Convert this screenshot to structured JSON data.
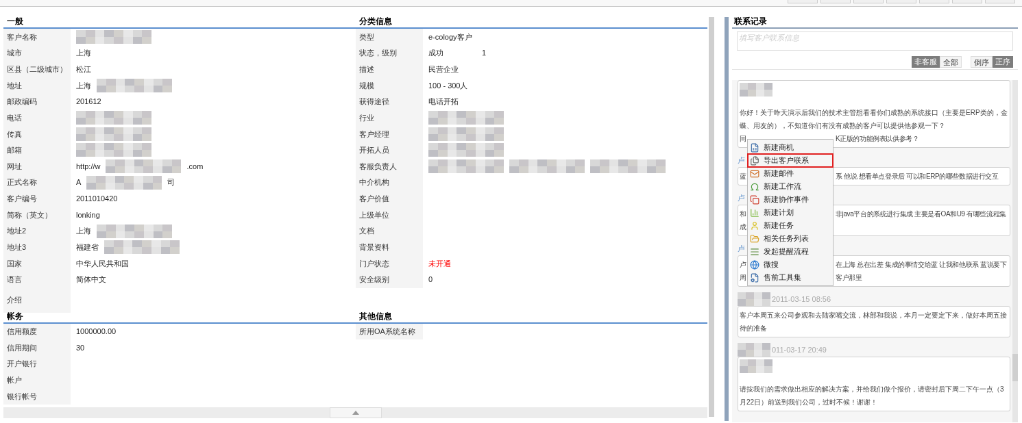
{
  "sections": [
    {
      "left": {
        "title": "一般",
        "fields": [
          {
            "label": "客户名称",
            "segments": [
              {
                "kind": "redacted"
              }
            ]
          },
          {
            "label": "城市",
            "segments": [
              {
                "kind": "text",
                "text": "上海"
              }
            ]
          },
          {
            "label": "区县（二级城市）",
            "segments": [
              {
                "kind": "text",
                "text": "松江"
              }
            ]
          },
          {
            "label": "地址",
            "segments": [
              {
                "kind": "text",
                "text": "上海"
              },
              {
                "kind": "redacted"
              }
            ]
          },
          {
            "label": "邮政编码",
            "segments": [
              {
                "kind": "text",
                "text": "201612"
              }
            ]
          },
          {
            "label": "电话",
            "segments": [
              {
                "kind": "redacted"
              }
            ]
          },
          {
            "label": "传真",
            "segments": [
              {
                "kind": "redacted"
              }
            ]
          },
          {
            "label": "邮箱",
            "segments": [
              {
                "kind": "redacted"
              }
            ]
          },
          {
            "label": "网址",
            "segments": [
              {
                "kind": "text",
                "text": "http://w"
              },
              {
                "kind": "redacted"
              },
              {
                "kind": "text",
                "text": ".com"
              }
            ]
          },
          {
            "label": "正式名称",
            "segments": [
              {
                "kind": "text",
                "text": "A"
              },
              {
                "kind": "redacted"
              },
              {
                "kind": "text",
                "text": "司"
              }
            ]
          },
          {
            "label": "客户编号",
            "segments": [
              {
                "kind": "text",
                "text": "2011010420"
              }
            ]
          },
          {
            "label": "简称（英文）",
            "segments": [
              {
                "kind": "text",
                "text": "lonking"
              }
            ]
          },
          {
            "label": "地址2",
            "segments": [
              {
                "kind": "text",
                "text": "上海"
              },
              {
                "kind": "redacted"
              }
            ]
          },
          {
            "label": "地址3",
            "segments": [
              {
                "kind": "text",
                "text": "福建省"
              },
              {
                "kind": "redacted"
              }
            ]
          },
          {
            "label": "国家",
            "segments": [
              {
                "kind": "text",
                "text": "中华人民共和国"
              }
            ]
          },
          {
            "label": "语言",
            "segments": [
              {
                "kind": "text",
                "text": "简体中文"
              }
            ]
          },
          {
            "label": "介绍",
            "tall": true
          }
        ]
      },
      "right": {
        "title": "分类信息",
        "fields": [
          {
            "label": "类型",
            "segments": [
              {
                "kind": "text",
                "text": "e-cology客户"
              }
            ]
          },
          {
            "label": "状态，级别",
            "segments": [
              {
                "kind": "text",
                "text": "成功"
              },
              {
                "kind": "text",
                "text": "1"
              }
            ]
          },
          {
            "label": "描述",
            "segments": [
              {
                "kind": "text",
                "text": "民营企业"
              }
            ]
          },
          {
            "label": "规模",
            "segments": [
              {
                "kind": "text",
                "text": "100 - 300人"
              }
            ]
          },
          {
            "label": "获得途径",
            "segments": [
              {
                "kind": "text",
                "text": "电话开拓"
              }
            ]
          },
          {
            "label": "行业",
            "segments": [
              {
                "kind": "redacted"
              }
            ]
          },
          {
            "label": "客户经理",
            "segments": [
              {
                "kind": "redacted"
              }
            ]
          },
          {
            "label": "开拓人员",
            "segments": [
              {
                "kind": "redacted"
              }
            ]
          },
          {
            "label": "客服负责人",
            "segments": [
              {
                "kind": "redacted"
              },
              {
                "kind": "redacted"
              },
              {
                "kind": "redacted"
              }
            ]
          },
          {
            "label": "中介机构"
          },
          {
            "label": "客户价值"
          },
          {
            "label": "上级单位"
          },
          {
            "label": "文档"
          },
          {
            "label": "背景资料"
          },
          {
            "label": "门户状态",
            "segments": [
              {
                "kind": "alert",
                "text": "未开通"
              }
            ]
          },
          {
            "label": "安全级别",
            "segments": [
              {
                "kind": "text",
                "text": "0"
              }
            ]
          }
        ]
      }
    },
    {
      "left": {
        "title": "帐务",
        "fields": [
          {
            "label": "信用额度",
            "segments": [
              {
                "kind": "text",
                "text": "1000000.00"
              }
            ]
          },
          {
            "label": "信用期间",
            "segments": [
              {
                "kind": "text",
                "text": "30"
              }
            ]
          },
          {
            "label": "开户银行"
          },
          {
            "label": "帐户"
          },
          {
            "label": "银行帐号"
          }
        ]
      },
      "right": {
        "title": "其他信息",
        "fields": [
          {
            "label": "所用OA系统名称"
          }
        ]
      }
    }
  ],
  "contacts": {
    "title": "联系记录",
    "placeholder": "填写客户联系信息",
    "filter_buttons": [
      {
        "label": "非客服",
        "selected": true
      },
      {
        "label": "全部",
        "selected": false
      }
    ],
    "order_buttons": [
      {
        "label": "倒序",
        "selected": false
      },
      {
        "label": "正序",
        "selected": true
      }
    ],
    "messages": [
      {
        "author_redacted": true,
        "lines": [
          {
            "parts": [
              "你好！关于昨天演示后我们的技术主管想看看你们成熟的系统接口（主要是ERP类的，金蝶、用友的），不知道你们有没有成熟的客户可以提供他参观一下？"
            ]
          },
          {
            "parts": [
              "同",
              "K正版的功能例表以供参考？"
            ]
          }
        ]
      },
      {
        "header": [
          {
            "kind": "link",
            "text": "卢"
          }
        ],
        "author_redacted": false,
        "lines": [
          {
            "parts": [
              "蓝",
              "系 他说 想看单点登录后 可以和ERP的哪些数据进行交互"
            ]
          }
        ]
      },
      {
        "header": [
          {
            "kind": "link",
            "text": "卢"
          }
        ],
        "author_redacted": false,
        "lines": [
          {
            "parts": [
              "和",
              "非java平台的系统进行集成 主要是看OA和U9 有哪些流程集"
            ]
          },
          {
            "parts": [
              "成"
            ]
          }
        ]
      },
      {
        "header": [
          {
            "kind": "link",
            "text": "卢"
          }
        ],
        "author_redacted": false,
        "lines": [
          {
            "parts": [
              "卢",
              "在上海 总在出差 集成的事情交给蓝 让我和他联系 蓝说要下"
            ]
          },
          {
            "parts": [
              "周",
              "客户那里"
            ]
          }
        ]
      },
      {
        "header": [
          {
            "kind": "redacted"
          },
          {
            "kind": "time",
            "text": "2011-03-15 08:56"
          }
        ],
        "author_redacted": false,
        "lines": [
          {
            "parts": [
              "客户本周五来公司参观和去陆家嘴交流，林部和我说，本月一定要定下来，做好本周五接待的准备"
            ]
          }
        ]
      },
      {
        "header": [
          {
            "kind": "redacted"
          },
          {
            "kind": "time",
            "text": "011-03-17 20:49"
          }
        ],
        "author_redacted": true,
        "lines": [
          {
            "parts": [
              "请按我们的需求做出相应的解决方案，并给我们做个报价，请密封后下周二下午一点（3月22日）前送到我们公司，过时不候！谢谢！"
            ]
          }
        ]
      }
    ]
  },
  "context_menu": [
    {
      "label": "新建商机",
      "highlighted": false
    },
    {
      "label": "导出客户联系",
      "highlighted": true
    },
    {
      "label": "新建邮件",
      "highlighted": false
    },
    {
      "label": "新建工作流",
      "highlighted": false
    },
    {
      "label": "新建协作事件",
      "highlighted": false
    },
    {
      "label": "新建计划",
      "highlighted": false
    },
    {
      "label": "新建任务",
      "highlighted": false
    },
    {
      "label": "相关任务列表",
      "highlighted": false
    },
    {
      "label": "发起提醒流程",
      "highlighted": false
    },
    {
      "label": "微搜",
      "highlighted": false
    },
    {
      "label": "售前工具集",
      "highlighted": false
    }
  ]
}
